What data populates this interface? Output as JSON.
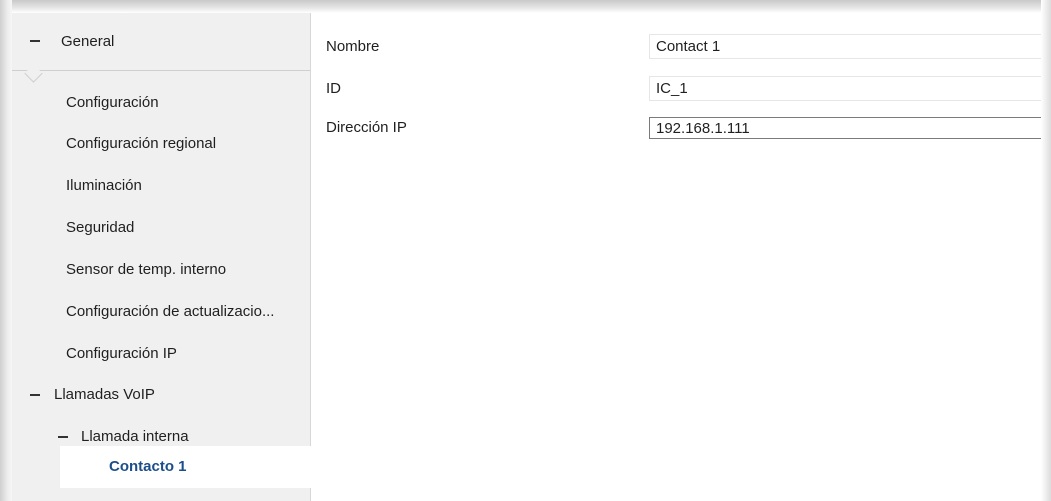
{
  "sidebar": {
    "header_label": "General",
    "items": [
      {
        "label": "Configuración"
      },
      {
        "label": "Configuración regional"
      },
      {
        "label": "Iluminación"
      },
      {
        "label": "Seguridad"
      },
      {
        "label": "Sensor de temp. interno"
      },
      {
        "label": "Configuración de actualizacio..."
      },
      {
        "label": "Configuración IP"
      }
    ],
    "voip_label": "Llamadas VoIP",
    "internal_label": "Llamada interna",
    "selected_label": "Contacto 1"
  },
  "form": {
    "name": {
      "label": "Nombre",
      "value": "Contact 1"
    },
    "id": {
      "label": "ID",
      "value": "IC_1"
    },
    "ip": {
      "label": "Dirección IP",
      "value": "192.168.1.111"
    }
  }
}
